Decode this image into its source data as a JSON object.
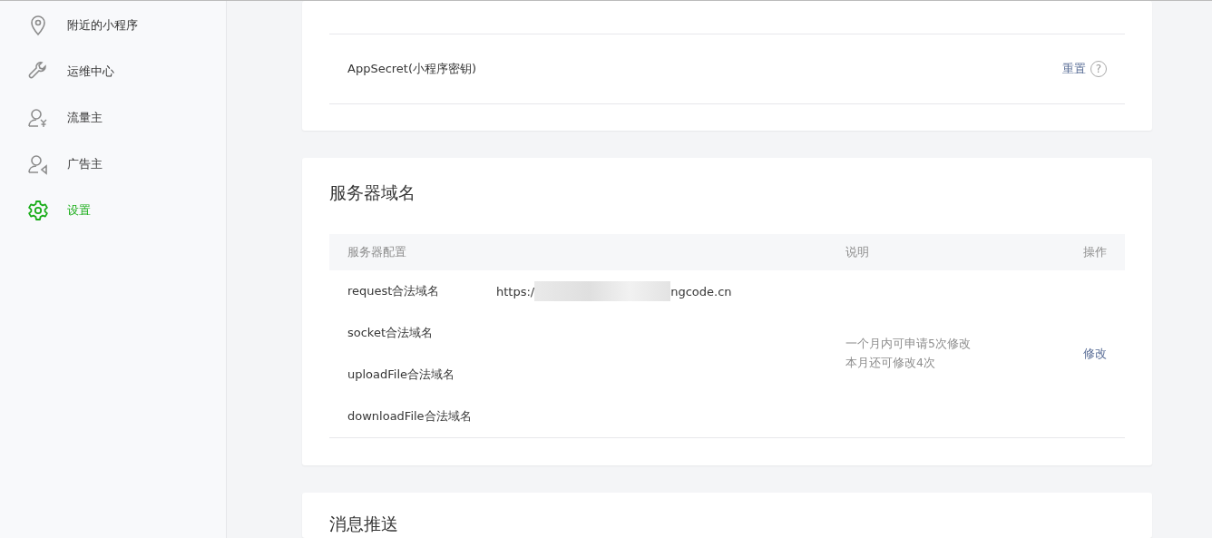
{
  "sidebar": {
    "items": [
      {
        "label": "附近的小程序",
        "selected": false
      },
      {
        "label": "运维中心",
        "selected": false
      },
      {
        "label": "流量主",
        "selected": false
      },
      {
        "label": "广告主",
        "selected": false
      },
      {
        "label": "设置",
        "selected": true
      }
    ]
  },
  "secret_card": {
    "label": "AppSecret(小程序密钥)",
    "action": "重置",
    "help": "?"
  },
  "server_card": {
    "title": "服务器域名",
    "columns": [
      "服务器配置",
      "说明",
      "操作"
    ],
    "rows": [
      {
        "name": "request合法域名",
        "url_prefix": "https:/",
        "url_suffix": "ngcode.cn"
      },
      {
        "name": "socket合法域名"
      },
      {
        "name": "uploadFile合法域名"
      },
      {
        "name": "downloadFile合法域名"
      }
    ],
    "notes": [
      "一个月内可申请5次修改",
      "本月还可修改4次"
    ],
    "action": "修改"
  },
  "message_card": {
    "title": "消息推送"
  }
}
